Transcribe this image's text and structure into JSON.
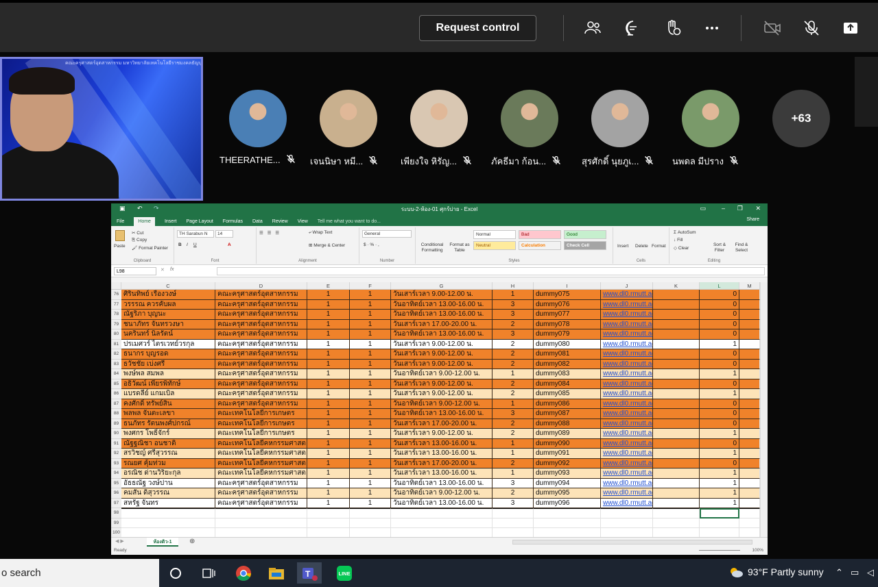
{
  "teams": {
    "request_control": "Request control",
    "toolbar_icons": [
      "people-icon",
      "chat-icon",
      "raise-hand-icon",
      "more-icon",
      "camera-off-icon",
      "mic-off-icon",
      "share-tray-icon"
    ],
    "presenter_caption": "คณะครุศาสตร์อุตสาหกรรม มหาวิทยาลัยเทคโนโลยีราชมงคลธัญบุรี",
    "participants": [
      {
        "name": "THEERATHE...",
        "color": "#4a7fb5"
      },
      {
        "name": "เจนนิษา หมี...",
        "color": "#c9b08e"
      },
      {
        "name": "เพียงใจ หิรัญ...",
        "color": "#d9c7b2"
      },
      {
        "name": "ภัคธีมา ก้อน...",
        "color": "#6a7a5a"
      },
      {
        "name": "สุรศักดิ์ นุยภูเ...",
        "color": "#a3a3a3"
      },
      {
        "name": "นพดล มีปราง",
        "color": "#7a9a6a"
      }
    ],
    "more_count": "+63"
  },
  "excel": {
    "title": "ระบบ-2-ห้อง-01 ศุกร์บ่าย - Excel",
    "tabs": [
      "File",
      "Home",
      "Insert",
      "Page Layout",
      "Formulas",
      "Data",
      "Review",
      "View"
    ],
    "tell_me": "Tell me what you want to do...",
    "share": "Share",
    "ribbon": {
      "paste": "Paste",
      "cut": "Cut",
      "copy": "Copy",
      "format_painter": "Format Painter",
      "clipboard": "Clipboard",
      "font_name": "TH Sarabun N",
      "font_size": "14",
      "font": "Font",
      "wrap_text": "Wrap Text",
      "merge_center": "Merge & Center",
      "alignment": "Alignment",
      "number_format": "General",
      "number": "Number",
      "conditional": "Conditional Formatting",
      "format_table": "Format as Table",
      "styles": "Styles",
      "style_normal": "Normal",
      "style_bad": "Bad",
      "style_good": "Good",
      "style_neutral": "Neutral",
      "style_calc": "Calculation",
      "style_check": "Check Cell",
      "insert": "Insert",
      "delete": "Delete",
      "format": "Format",
      "cells": "Cells",
      "autosum": "AutoSum",
      "fill": "Fill",
      "clear": "Clear",
      "sort_filter": "Sort & Filter",
      "find_select": "Find & Select",
      "editing": "Editing"
    },
    "name_box": "L98",
    "fx": "fx",
    "columns": [
      "C",
      "D",
      "E",
      "F",
      "G",
      "H",
      "I",
      "J",
      "K",
      "L",
      "M"
    ],
    "rows": [
      {
        "n": "76",
        "name": "ศิรินทิพย์ เรืองวงษ์",
        "faculty": "คณะครุศาสตร์อุตสาหกรรม",
        "e": "1",
        "f": "1",
        "time": "วันเสาร์เวลา 9.00-12.00 น.",
        "h": "1",
        "user": "dummy075",
        "url": "www.dl0.rmutt.ac.th",
        "l": "0",
        "fill": "#f0822a"
      },
      {
        "n": "77",
        "name": "วรรรณ ควรคับผล",
        "faculty": "คณะครุศาสตร์อุตสาหกรรม",
        "e": "1",
        "f": "1",
        "time": "วันอาทิตย์เวลา 13.00-16.00 น.",
        "h": "3",
        "user": "dummy076",
        "url": "www.dl0.rmutt.ac.th",
        "l": "0",
        "fill": "#f0822a"
      },
      {
        "n": "78",
        "name": "ณัฐริภา บุญนะ",
        "faculty": "คณะครุศาสตร์อุตสาหกรรม",
        "e": "1",
        "f": "1",
        "time": "วันอาทิตย์เวลา 13.00-16.00 น.",
        "h": "3",
        "user": "dummy077",
        "url": "www.dl0.rmutt.ac.th",
        "l": "0",
        "fill": "#f0822a"
      },
      {
        "n": "79",
        "name": "ชนาภัทร จันทรวงษา",
        "faculty": "คณะครุศาสตร์อุตสาหกรรม",
        "e": "1",
        "f": "1",
        "time": "วันเสาร์เวลา 17.00-20.00 น.",
        "h": "2",
        "user": "dummy078",
        "url": "www.dl0.rmutt.ac.th",
        "l": "0",
        "fill": "#f0822a"
      },
      {
        "n": "80",
        "name": "นครินทร์ นิลรัตน์",
        "faculty": "คณะครุศาสตร์อุตสาหกรรม",
        "e": "1",
        "f": "1",
        "time": "วันอาทิตย์เวลา 13.00-16.00 น.",
        "h": "3",
        "user": "dummy079",
        "url": "www.dl0.rmutt.ac.th",
        "l": "0",
        "fill": "#f0822a"
      },
      {
        "n": "81",
        "name": "ปรเมศวร์ ไตรเวทย์วรกุล",
        "faculty": "คณะครุศาสตร์อุตสาหกรรม",
        "e": "1",
        "f": "1",
        "time": "วันเสาร์เวลา 9.00-12.00 น.",
        "h": "2",
        "user": "dummy080",
        "url": "www.dl0.rmutt.ac.th",
        "l": "1",
        "fill": "#ffffff"
      },
      {
        "n": "82",
        "name": "ธนากร บุญรอด",
        "faculty": "คณะครุศาสตร์อุตสาหกรรม",
        "e": "1",
        "f": "1",
        "time": "วันเสาร์เวลา 9.00-12.00 น.",
        "h": "2",
        "user": "dummy081",
        "url": "www.dl0.rmutt.ac.th",
        "l": "0",
        "fill": "#f0822a"
      },
      {
        "n": "83",
        "name": "ธวัชชัย เบ่งศรี",
        "faculty": "คณะครุศาสตร์อุตสาหกรรม",
        "e": "1",
        "f": "1",
        "time": "วันเสาร์เวลา 9.00-12.00 น.",
        "h": "2",
        "user": "dummy082",
        "url": "www.dl0.rmutt.ac.th",
        "l": "0",
        "fill": "#f0822a"
      },
      {
        "n": "84",
        "name": "พงษ์พล สมพล",
        "faculty": "คณะครุศาสตร์อุตสาหกรรม",
        "e": "1",
        "f": "1",
        "time": "วันอาทิตย์เวลา 9.00-12.00 น.",
        "h": "1",
        "user": "dummy083",
        "url": "www.dl0.rmutt.ac.th",
        "l": "1",
        "fill": "#fde3b8"
      },
      {
        "n": "85",
        "name": "อธิวัฒน์ เพียรพิทักษ์",
        "faculty": "คณะครุศาสตร์อุตสาหกรรม",
        "e": "1",
        "f": "1",
        "time": "วันเสาร์เวลา 9.00-12.00 น.",
        "h": "2",
        "user": "dummy084",
        "url": "www.dl0.rmutt.ac.th",
        "l": "0",
        "fill": "#f0822a"
      },
      {
        "n": "86",
        "name": "แบรดลีย์ แกมเบิล",
        "faculty": "คณะครุศาสตร์อุตสาหกรรม",
        "e": "1",
        "f": "1",
        "time": "วันเสาร์เวลา 9.00-12.00 น.",
        "h": "2",
        "user": "dummy085",
        "url": "www.dl0.rmutt.ac.th",
        "l": "1",
        "fill": "#fde3b8"
      },
      {
        "n": "87",
        "name": "คงศักดิ์ ทรัพย์สิน",
        "faculty": "คณะครุศาสตร์อุตสาหกรรม",
        "e": "1",
        "f": "1",
        "time": "วันอาทิตย์เวลา 9.00-12.00 น.",
        "h": "1",
        "user": "dummy086",
        "url": "www.dl0.rmutt.ac.th",
        "l": "0",
        "fill": "#f0822a"
      },
      {
        "n": "88",
        "name": "พลพล จันตะเลขา",
        "faculty": "คณะเทคโนโลยีการเกษตร",
        "e": "1",
        "f": "1",
        "time": "วันอาทิตย์เวลา 13.00-16.00 น.",
        "h": "3",
        "user": "dummy087",
        "url": "www.dl0.rmutt.ac.th",
        "l": "0",
        "fill": "#f0822a"
      },
      {
        "n": "89",
        "name": "ธนภัทร รัตนพงศ์ปกรณ์",
        "faculty": "คณะเทคโนโลยีการเกษตร",
        "e": "1",
        "f": "1",
        "time": "วันเสาร์เวลา 17.00-20.00 น.",
        "h": "2",
        "user": "dummy088",
        "url": "www.dl0.rmutt.ac.th",
        "l": "0",
        "fill": "#f0822a"
      },
      {
        "n": "90",
        "name": "พงศกร โพธิ์จักร์",
        "faculty": "คณะเทคโนโลยีการเกษตร",
        "e": "1",
        "f": "1",
        "time": "วันเสาร์เวลา 9.00-12.00 น.",
        "h": "2",
        "user": "dummy089",
        "url": "www.dl0.rmutt.ac.th",
        "l": "1",
        "fill": "#fde3b8"
      },
      {
        "n": "91",
        "name": "ณัฐฐณิชา อนชาติ",
        "faculty": "คณะเทคโนโลยีคหกรรมศาสต",
        "e": "1",
        "f": "1",
        "time": "วันเสาร์เวลา 13.00-16.00 น.",
        "h": "1",
        "user": "dummy090",
        "url": "www.dl0.rmutt.ac.th",
        "l": "0",
        "fill": "#f0822a"
      },
      {
        "n": "92",
        "name": "สรวิชญ์ ศรีสุวรรณ",
        "faculty": "คณะเทคโนโลยีคหกรรมศาสต",
        "e": "1",
        "f": "1",
        "time": "วันเสาร์เวลา 13.00-16.00 น.",
        "h": "1",
        "user": "dummy091",
        "url": "www.dl0.rmutt.ac.th",
        "l": "1",
        "fill": "#fde3b8"
      },
      {
        "n": "93",
        "name": "รณยศ คุ้มท่วม",
        "faculty": "คณะเทคโนโลยีคหกรรมศาสต",
        "e": "1",
        "f": "1",
        "time": "วันเสาร์เวลา 17.00-20.00 น.",
        "h": "2",
        "user": "dummy092",
        "url": "www.dl0.rmutt.ac.th",
        "l": "0",
        "fill": "#f0822a"
      },
      {
        "n": "94",
        "name": "อรณิช ด่านวิริยะกุล",
        "faculty": "คณะเทคโนโลยีคหกรรมศาสต",
        "e": "1",
        "f": "1",
        "time": "วันเสาร์เวลา 13.00-16.00 น.",
        "h": "1",
        "user": "dummy093",
        "url": "www.dl0.rmutt.ac.th",
        "l": "1",
        "fill": "#fde3b8"
      },
      {
        "n": "95",
        "name": "อัธธณัฐ วงษ์ปาน",
        "faculty": "คณะครุศาสตร์อุตสาหกรรม",
        "e": "1",
        "f": "1",
        "time": "วันอาทิตย์เวลา 13.00-16.00 น.",
        "h": "3",
        "user": "dummy094",
        "url": "www.dl0.rmutt.ac.th",
        "l": "1",
        "fill": "#ffffff"
      },
      {
        "n": "96",
        "name": "คมสัน ดิสุวรรณ",
        "faculty": "คณะครุศาสตร์อุตสาหกรรม",
        "e": "1",
        "f": "1",
        "time": "วันอาทิตย์เวลา 9.00-12.00 น.",
        "h": "2",
        "user": "dummy095",
        "url": "www.dl0.rmutt.ac.th",
        "l": "1",
        "fill": "#fde3b8"
      },
      {
        "n": "97",
        "name": "สหรัฐ จันทร",
        "faculty": "คณะครุศาสตร์อุตสาหกรรม",
        "e": "1",
        "f": "1",
        "time": "วันอาทิตย์เวลา 13.00-16.00 น.",
        "h": "3",
        "user": "dummy096",
        "url": "www.dl0.rmutt.ac.th",
        "l": "1",
        "fill": "#ffffff"
      }
    ],
    "empty_rows": [
      "98",
      "99",
      "100"
    ],
    "sheet_tab": "ห้องติว-1",
    "status": "Ready",
    "zoom": "100%"
  },
  "taskbar": {
    "search": "o search",
    "apps": [
      "cortana-icon",
      "task-view-icon",
      "chrome-icon",
      "explorer-icon",
      "teams-icon",
      "line-icon"
    ],
    "weather": "93°F  Partly sunny"
  }
}
